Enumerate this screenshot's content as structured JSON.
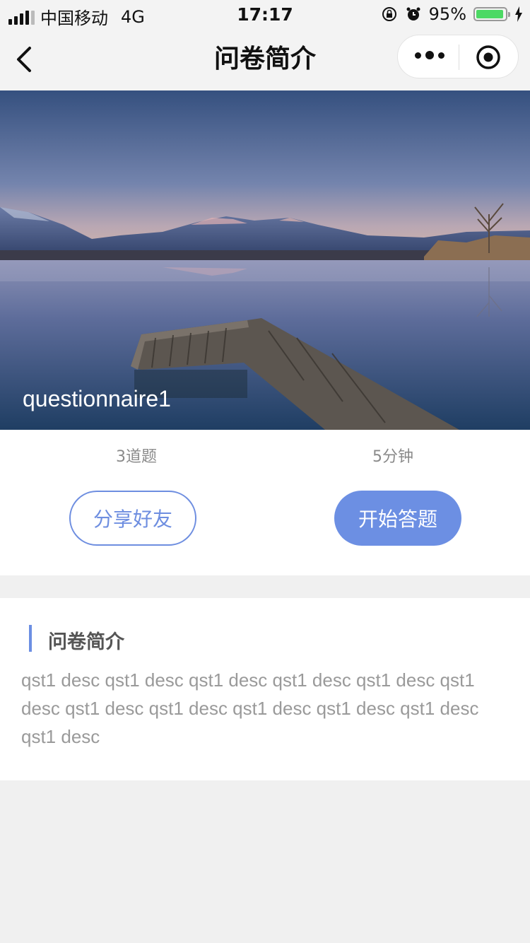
{
  "status_bar": {
    "carrier": "中国移动",
    "network": "4G",
    "time": "17:17",
    "battery_percent": "95%",
    "battery_level": 0.95
  },
  "nav": {
    "title": "问卷简介"
  },
  "hero": {
    "title": "questionnaire1"
  },
  "stats": {
    "questions": "3道题",
    "duration": "5分钟"
  },
  "buttons": {
    "share": "分享好友",
    "start": "开始答题"
  },
  "intro": {
    "heading": "问卷简介",
    "description": "qst1 desc qst1 desc qst1 desc qst1 desc qst1 desc qst1 desc qst1 desc qst1 desc qst1 desc qst1 desc qst1 desc qst1 desc"
  },
  "colors": {
    "accent": "#6c8fe3",
    "battery": "#4cd964"
  }
}
